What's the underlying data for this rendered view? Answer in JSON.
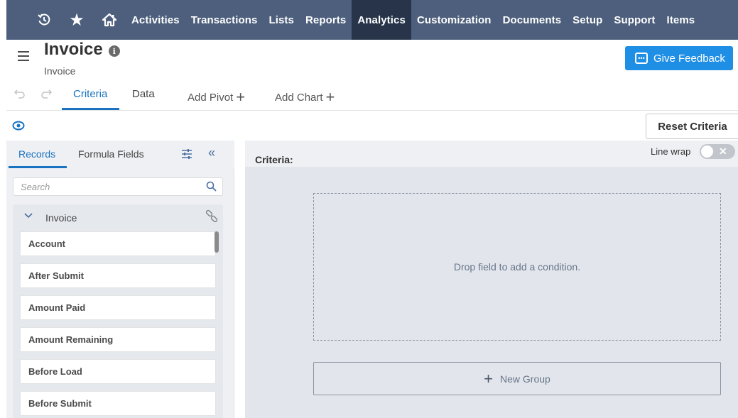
{
  "nav": {
    "items": [
      "Activities",
      "Transactions",
      "Lists",
      "Reports",
      "Analytics",
      "Customization",
      "Documents",
      "Setup",
      "Support",
      "Items"
    ],
    "active": "Analytics",
    "icons": [
      "recent-icon",
      "star-icon",
      "home-icon"
    ]
  },
  "header": {
    "title": "Invoice",
    "subtitle": "Invoice",
    "feedback_label": "Give Feedback"
  },
  "tabs": {
    "criteria": "Criteria",
    "data": "Data",
    "add_pivot": "Add Pivot",
    "add_chart": "Add Chart"
  },
  "toolbar": {
    "reset_label": "Reset Criteria"
  },
  "left_panel": {
    "tab_records": "Records",
    "tab_formula": "Formula Fields",
    "search_placeholder": "Search",
    "group_name": "Invoice",
    "fields": [
      "Account",
      "After Submit",
      "Amount Paid",
      "Amount Remaining",
      "Before Load",
      "Before Submit"
    ]
  },
  "criteria": {
    "title": "Criteria:",
    "line_wrap_label": "Line wrap",
    "drop_hint": "Drop field to add a condition.",
    "new_group_label": "New Group"
  },
  "colors": {
    "nav_bg": "#4d5f7c",
    "nav_active": "#27344a",
    "accent": "#1a73c0",
    "feedback_btn": "#1f8fe5"
  }
}
